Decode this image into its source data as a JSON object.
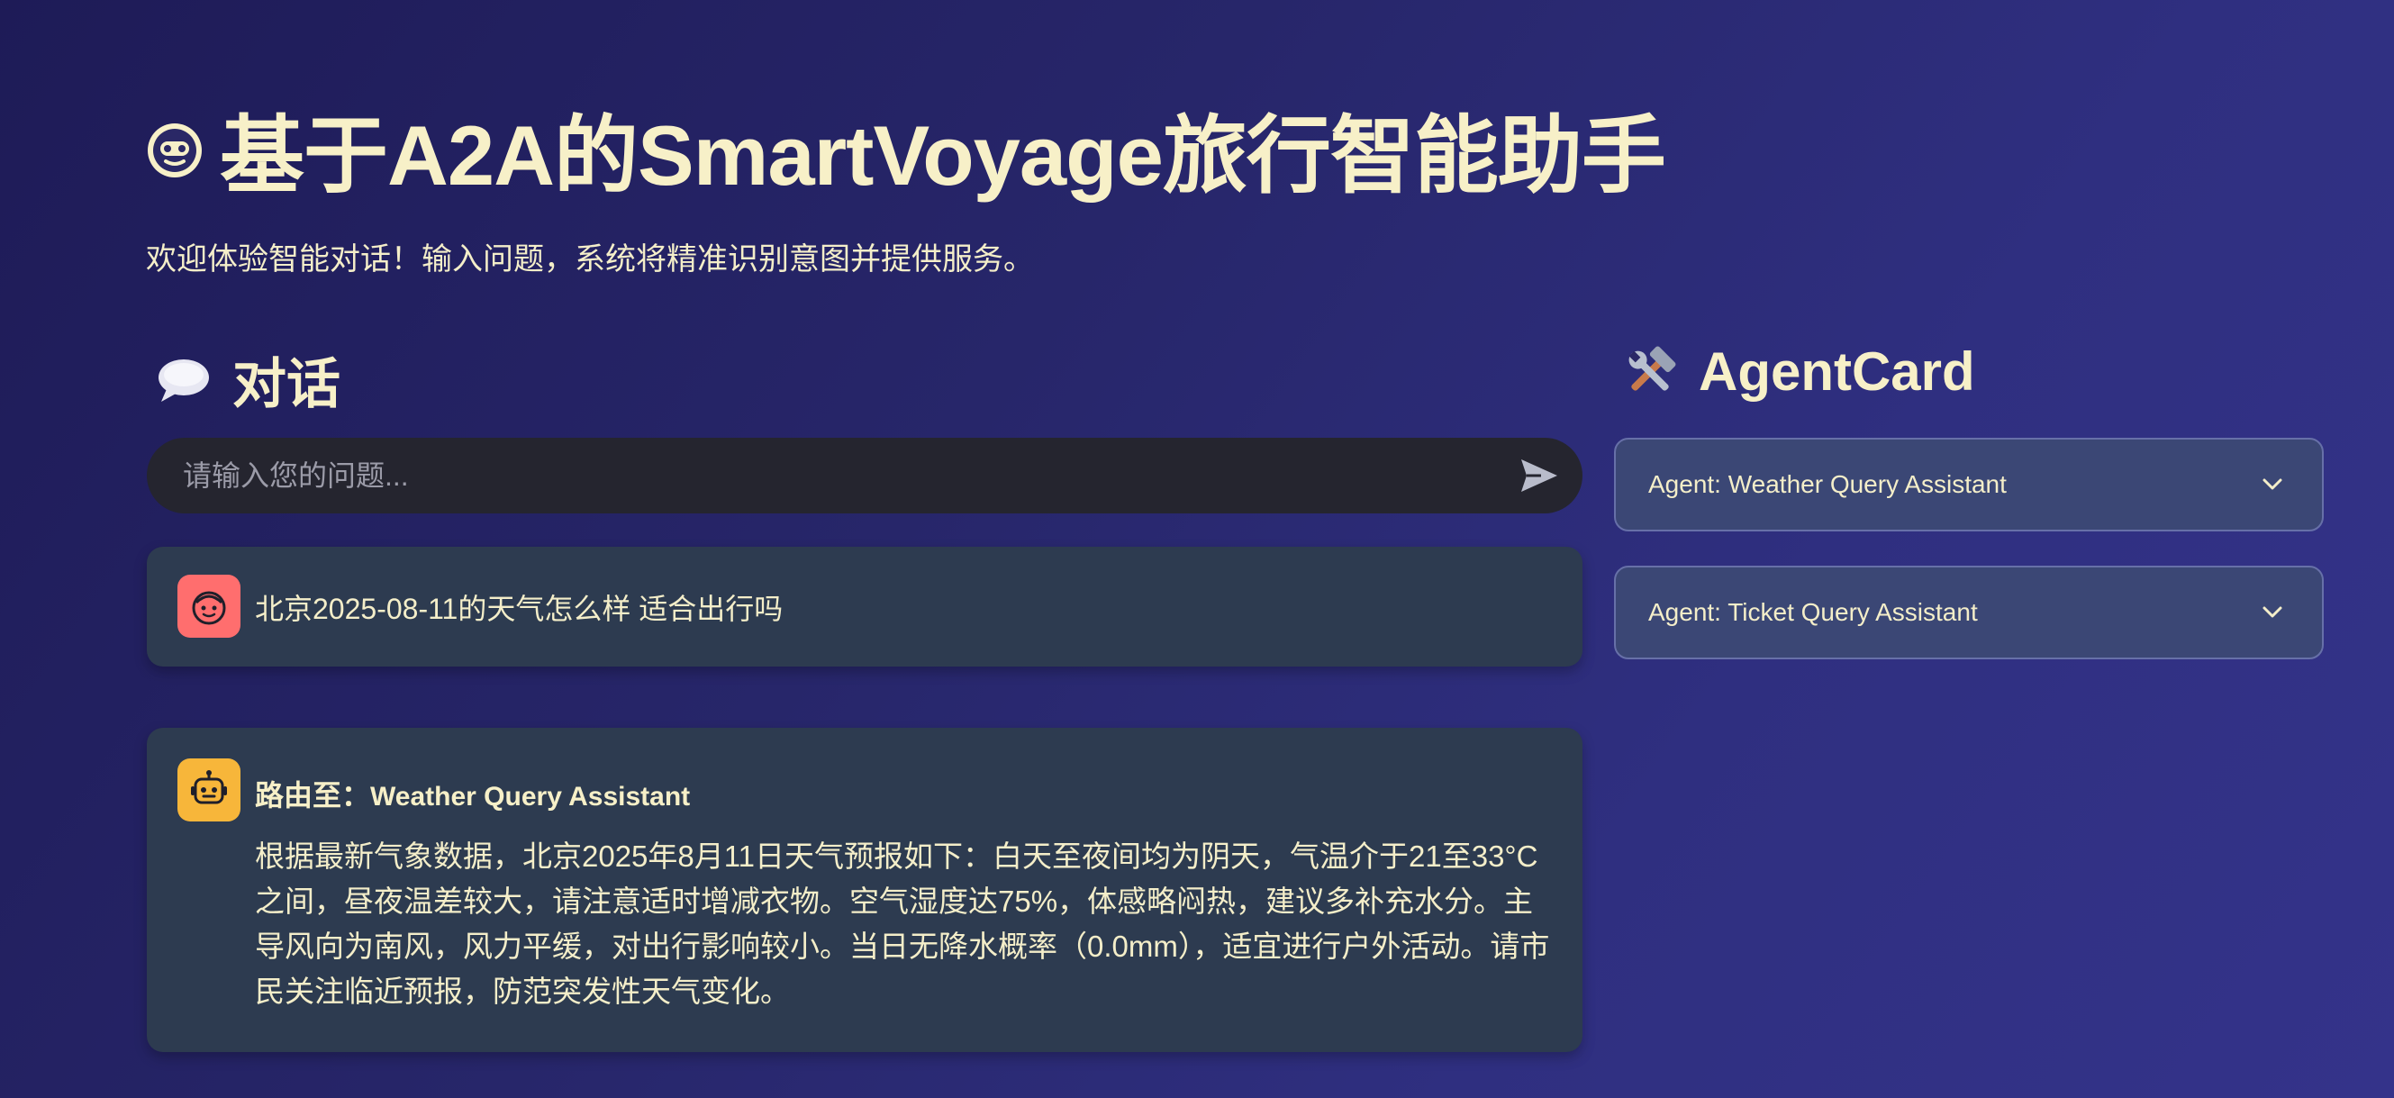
{
  "header": {
    "title": "基于A2A的SmartVoyage旅行智能助手",
    "title_icon": "robot-face-icon",
    "subtitle": "欢迎体验智能对话！输入问题，系统将精准识别意图并提供服务。"
  },
  "chat": {
    "heading": "对话",
    "heading_icon": "speech-balloon-icon",
    "input": {
      "value": "",
      "placeholder": "请输入您的问题..."
    },
    "messages": [
      {
        "role": "user",
        "avatar_icon": "user-face-icon",
        "text": "北京2025-08-11的天气怎么样 适合出行吗"
      },
      {
        "role": "assistant",
        "avatar_icon": "robot-icon",
        "route_prefix": "路由至：",
        "route_target": "Weather Query Assistant",
        "text": "根据最新气象数据，北京2025年8月11日天气预报如下：白天至夜间均为阴天，气温介于21至33°C之间，昼夜温差较大，请注意适时增减衣物。空气湿度达75%，体感略闷热，建议多补充水分。主导风向为南风，风力平缓，对出行影响较小。当日无降水概率（0.0mm），适宜进行户外活动。请市民关注临近预报，防范突发性天气变化。"
      }
    ]
  },
  "agents": {
    "heading": "AgentCard",
    "heading_icon": "hammer-wrench-icon",
    "cards": [
      {
        "label": "Agent: Weather Query Assistant"
      },
      {
        "label": "Agent: Ticket Query Assistant"
      }
    ]
  },
  "colors": {
    "background_start": "#1e1b57",
    "background_end": "#34338a",
    "text": "#f4eec9",
    "input_bg": "#25252f",
    "message_bg": "#2d3b50",
    "card_bg": "#3b4775",
    "card_border": "#6770a8",
    "user_avatar": "#ff6e6e",
    "assistant_avatar": "#f7b63a"
  }
}
